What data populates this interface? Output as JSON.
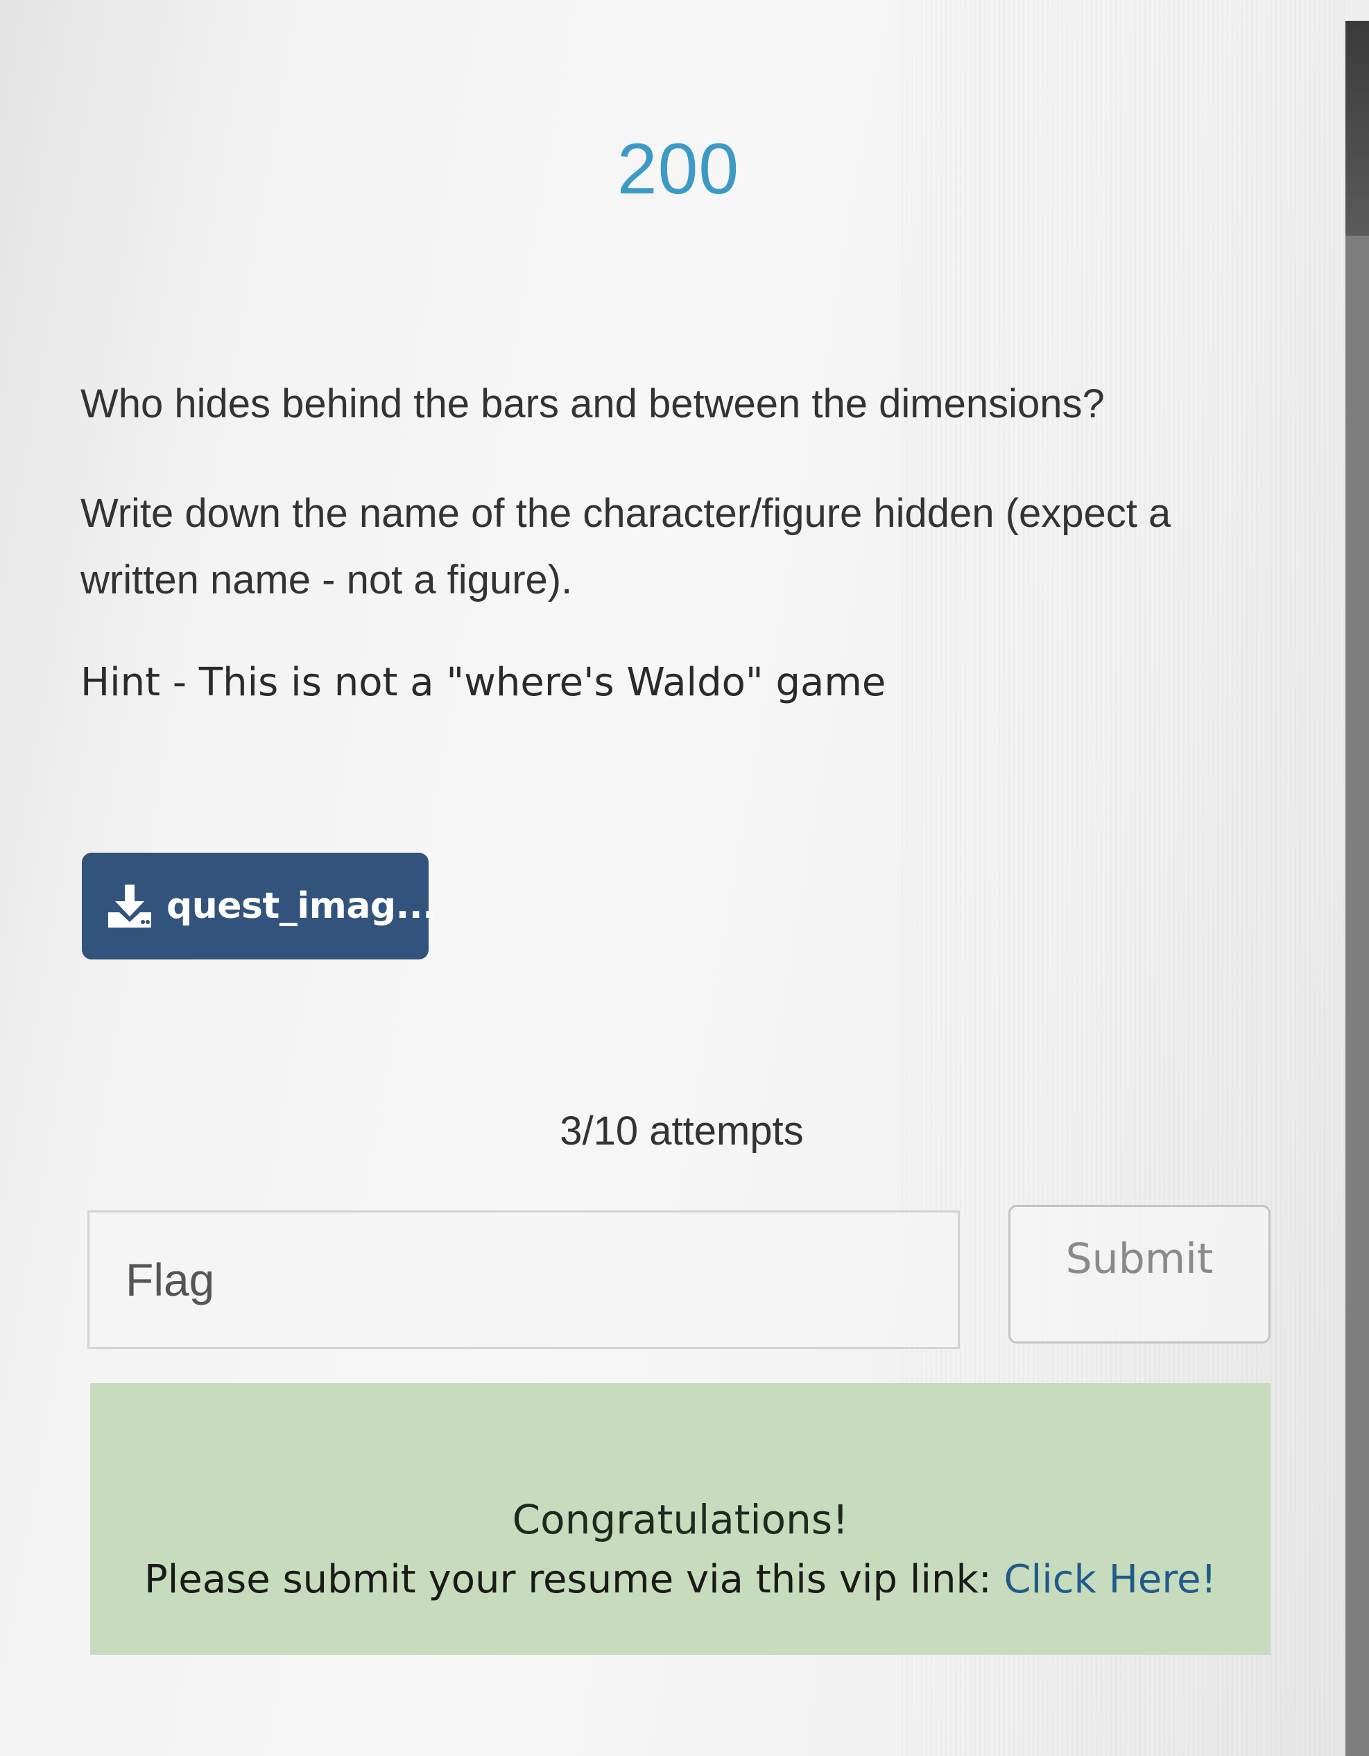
{
  "challenge": {
    "points": "200",
    "question_line_1": "Who hides behind the bars and between the dimensions?",
    "question_line_2": "Write down the name of the character/figure hidden (expect a written name - not a figure).",
    "hint": "Hint - This is not a \"where's Waldo\" game"
  },
  "attachment": {
    "label": "quest_imag...",
    "icon": "download-icon"
  },
  "attempts_text": "3/10 attempts",
  "form": {
    "flag_placeholder": "Flag",
    "flag_value": "",
    "submit_label": "Submit"
  },
  "alert": {
    "title": "Congratulations!",
    "body_prefix": "Please submit your resume via this vip link: ",
    "link_text": "Click Here!"
  },
  "colors": {
    "points": "#3c9ac5",
    "download_button": "#32537c",
    "success_alert": "#c7dcbc",
    "link": "#1f5a8a"
  }
}
